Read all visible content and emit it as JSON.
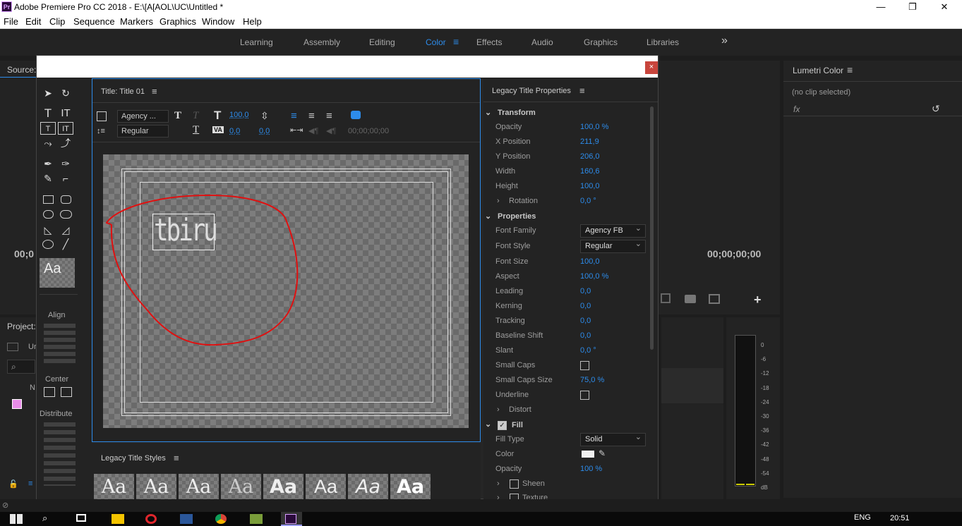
{
  "app": {
    "title": "Adobe Premiere Pro CC 2018 - E:\\[A[AOL\\UC\\Untitled *",
    "logo": "Pr"
  },
  "window_controls": {
    "minimize": "—",
    "maximize": "❐",
    "close": "✕"
  },
  "menu": [
    "File",
    "Edit",
    "Clip",
    "Sequence",
    "Markers",
    "Graphics",
    "Window",
    "Help"
  ],
  "workspaces": [
    {
      "label": "Learning",
      "active": false
    },
    {
      "label": "Assembly",
      "active": false
    },
    {
      "label": "Editing",
      "active": false
    },
    {
      "label": "Color",
      "active": true
    },
    {
      "label": "Effects",
      "active": false
    },
    {
      "label": "Audio",
      "active": false
    },
    {
      "label": "Graphics",
      "active": false
    },
    {
      "label": "Libraries",
      "active": false
    }
  ],
  "workspace_overflow": "»",
  "panels": {
    "source": "Source:",
    "project": "Project:",
    "project_item": "Ur",
    "project_col": "N",
    "lumetri_title": "Lumetri Color",
    "lumetri_noclip": "(no clip selected)",
    "lumetri_fx": "fx",
    "source_time": "00;0",
    "program_time": "00;00;00;00",
    "add": "+"
  },
  "meter_ticks": [
    "0",
    "-6",
    "-12",
    "-18",
    "-24",
    "-30",
    "-36",
    "-42",
    "-48",
    "-54",
    "dB"
  ],
  "dialog": {
    "close": "×"
  },
  "tools_panel": {
    "align": "Align",
    "center": "Center",
    "distribute": "Distribute",
    "style_preview": "Aa"
  },
  "title_panel": {
    "title": "Title: Title 01",
    "font_family": "Agency ...",
    "font_style": "Regular",
    "font_size": "100,0",
    "kerning": "0,0",
    "leading": "0,0",
    "timecode": "00;00;00;00",
    "canvas_text": "tbiru"
  },
  "properties": {
    "title": "Legacy Title Properties",
    "transform": "Transform",
    "opacity": [
      "Opacity",
      "100,0 %"
    ],
    "x_position": [
      "X Position",
      "211,9"
    ],
    "y_position": [
      "Y Position",
      "206,0"
    ],
    "width": [
      "Width",
      "160,6"
    ],
    "height": [
      "Height",
      "100,0"
    ],
    "rotation": [
      "Rotation",
      "0,0 °"
    ],
    "properties": "Properties",
    "font_family": [
      "Font Family",
      "Agency FB"
    ],
    "font_style": [
      "Font Style",
      "Regular"
    ],
    "font_size": [
      "Font Size",
      "100,0"
    ],
    "aspect": [
      "Aspect",
      "100,0 %"
    ],
    "leading": [
      "Leading",
      "0,0"
    ],
    "kerning": [
      "Kerning",
      "0,0"
    ],
    "tracking": [
      "Tracking",
      "0,0"
    ],
    "baseline_shift": [
      "Baseline Shift",
      "0,0"
    ],
    "slant": [
      "Slant",
      "0,0 °"
    ],
    "small_caps": "Small Caps",
    "small_caps_size": [
      "Small Caps Size",
      "75,0 %"
    ],
    "underline": "Underline",
    "distort": "Distort",
    "fill": "Fill",
    "fill_type": [
      "Fill Type",
      "Solid"
    ],
    "color": "Color",
    "fill_opacity": [
      "Opacity",
      "100 %"
    ],
    "sheen": "Sheen",
    "texture": "Texture"
  },
  "styles": {
    "title": "Legacy Title Styles",
    "swatches": [
      "Aa",
      "Aa",
      "Aa",
      "Aa",
      "Aa",
      "Aa",
      "Aa",
      "Aa"
    ]
  },
  "taskbar": {
    "clock": "20:51",
    "lang": "ENG"
  },
  "colors": {
    "accent": "#2d8ceb",
    "annotation": "#e01010",
    "fill_color": "#f0f0f0"
  }
}
